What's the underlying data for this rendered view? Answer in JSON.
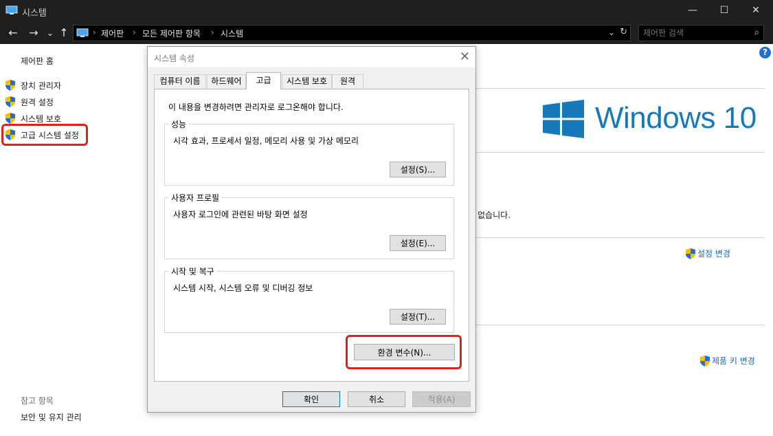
{
  "window": {
    "title": "시스템",
    "controls": {
      "minimize": "—",
      "maximize": "☐",
      "close": "✕"
    }
  },
  "nav": {
    "back": "←",
    "forward": "→",
    "recent": "⌄",
    "up": "↑"
  },
  "address": {
    "crumbs": [
      "제어판",
      "모든 제어판 항목",
      "시스템"
    ],
    "separator": "›",
    "dropdown": "⌄",
    "refresh": "↻"
  },
  "search": {
    "placeholder": "제어판 검색",
    "icon": "⌕"
  },
  "sidebar": {
    "home": "제어판 홈",
    "items": [
      {
        "label": "장치 관리자",
        "icon": "uac-shield-icon"
      },
      {
        "label": "원격 설정",
        "icon": "uac-shield-icon"
      },
      {
        "label": "시스템 보호",
        "icon": "uac-shield-icon"
      },
      {
        "label": "고급 시스템 설정",
        "icon": "uac-shield-icon",
        "highlighted": true
      }
    ],
    "see_also": "참고 항목",
    "see_also_link": "보안 및 유지 관리"
  },
  "main": {
    "help": "?",
    "logo_text": "Windows 10",
    "partial_text": "없습니다.",
    "change_settings": "설정 변경",
    "change_product_key": "제품 키 변경"
  },
  "dialog": {
    "title": "시스템 속성",
    "close": "✕",
    "tabs": [
      "컴퓨터 이름",
      "하드웨어",
      "고급",
      "시스템 보호",
      "원격"
    ],
    "active_tab": "고급",
    "admin_note": "이 내용을 변경하려면 관리자로 로그온해야 합니다.",
    "groups": [
      {
        "title": "성능",
        "description": "시각 효과, 프로세서 일정, 메모리 사용 및 가상 메모리",
        "button": "설정(S)..."
      },
      {
        "title": "사용자 프로필",
        "description": "사용자 로그인에 관련된 바탕 화면 설정",
        "button": "설정(E)..."
      },
      {
        "title": "시작 및 복구",
        "description": "시스템 시작, 시스템 오류 및 디버깅 정보",
        "button": "설정(T)..."
      }
    ],
    "env_button": "환경 변수(N)...",
    "ok": "확인",
    "cancel": "취소",
    "apply": "적용(A)"
  },
  "colors": {
    "highlight": "#e0201b",
    "windows_blue": "#1779ba",
    "link_blue": "#1a66b0"
  }
}
